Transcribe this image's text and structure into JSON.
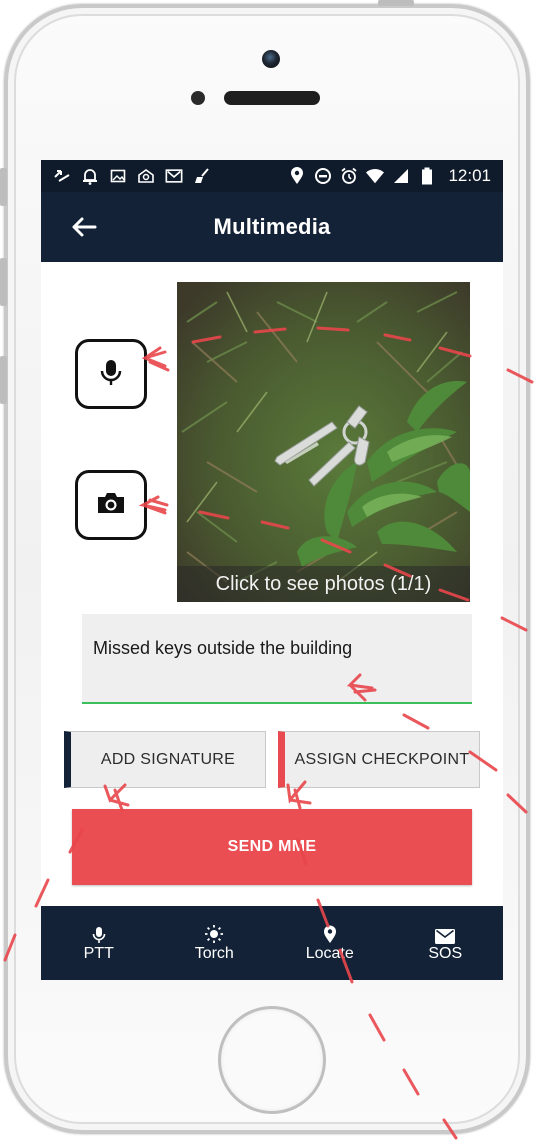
{
  "status_bar": {
    "time": "12:01",
    "left_icons": [
      "missed-call-icon",
      "bell-icon",
      "image-icon",
      "mailbox-icon",
      "gmail-icon",
      "broom-icon"
    ],
    "right_icons": [
      "location-pin-icon",
      "do-not-disturb-icon",
      "alarm-icon",
      "wifi-icon",
      "signal-icon",
      "battery-icon"
    ]
  },
  "app_bar": {
    "title": "Multimedia",
    "back_icon": "back-arrow-icon"
  },
  "media": {
    "audio_icon": "microphone-icon",
    "camera_icon": "camera-icon",
    "photo_caption": "Click to see photos (1/1)"
  },
  "note": {
    "value": "Missed keys outside the building"
  },
  "actions": {
    "add_signature": "ADD SIGNATURE",
    "assign_checkpoint": "ASSIGN CHECKPOINT",
    "send": "SEND MME"
  },
  "bottom_nav": {
    "items": [
      {
        "label": "PTT",
        "icon": "microphone-icon"
      },
      {
        "label": "Torch",
        "icon": "sun-icon"
      },
      {
        "label": "Locate",
        "icon": "location-pin-icon"
      },
      {
        "label": "SOS",
        "icon": "envelope-icon"
      }
    ]
  },
  "colors": {
    "app_bar": "#132236",
    "status_bar": "#0f1b2a",
    "accent_red": "#ea4e52",
    "underline_green": "#3bbf5a"
  }
}
